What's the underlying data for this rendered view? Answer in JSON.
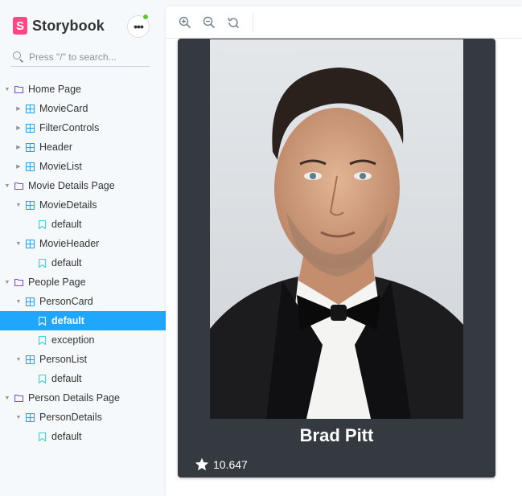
{
  "brand": {
    "name": "Storybook",
    "logo_letter": "S"
  },
  "search": {
    "placeholder": "Press \"/\" to search..."
  },
  "menu": {
    "label": "•••"
  },
  "tree": [
    {
      "label": "Home Page",
      "type": "group",
      "level": 0
    },
    {
      "label": "MovieCard",
      "type": "component",
      "level": 1,
      "collapsed": true
    },
    {
      "label": "FilterControls",
      "type": "component",
      "level": 1,
      "collapsed": true
    },
    {
      "label": "Header",
      "type": "component",
      "level": 1,
      "collapsed": true
    },
    {
      "label": "MovieList",
      "type": "component",
      "level": 1,
      "collapsed": true
    },
    {
      "label": "Movie Details Page",
      "type": "group",
      "level": 0
    },
    {
      "label": "MovieDetails",
      "type": "component",
      "level": 1
    },
    {
      "label": "default",
      "type": "story",
      "level": 2
    },
    {
      "label": "MovieHeader",
      "type": "component",
      "level": 1
    },
    {
      "label": "default",
      "type": "story",
      "level": 2
    },
    {
      "label": "People Page",
      "type": "group",
      "level": 0
    },
    {
      "label": "PersonCard",
      "type": "component",
      "level": 1
    },
    {
      "label": "default",
      "type": "story",
      "level": 2,
      "selected": true
    },
    {
      "label": "exception",
      "type": "story",
      "level": 2
    },
    {
      "label": "PersonList",
      "type": "component",
      "level": 1
    },
    {
      "label": "default",
      "type": "story",
      "level": 2
    },
    {
      "label": "Person Details Page",
      "type": "group",
      "level": 0
    },
    {
      "label": "PersonDetails",
      "type": "component",
      "level": 1
    },
    {
      "label": "default",
      "type": "story",
      "level": 2
    }
  ],
  "toolbar": {
    "buttons": [
      "zoom-in-icon",
      "zoom-out-icon",
      "reset-zoom-icon"
    ]
  },
  "card": {
    "name": "Brad Pitt",
    "rating": "10.647"
  },
  "colors": {
    "accent": "#1ea7fd",
    "brand": "#ff4785",
    "card_bg": "#343a40",
    "folder": "#774dd7",
    "component": "#1ea7fd",
    "story": "#37d5d3"
  }
}
